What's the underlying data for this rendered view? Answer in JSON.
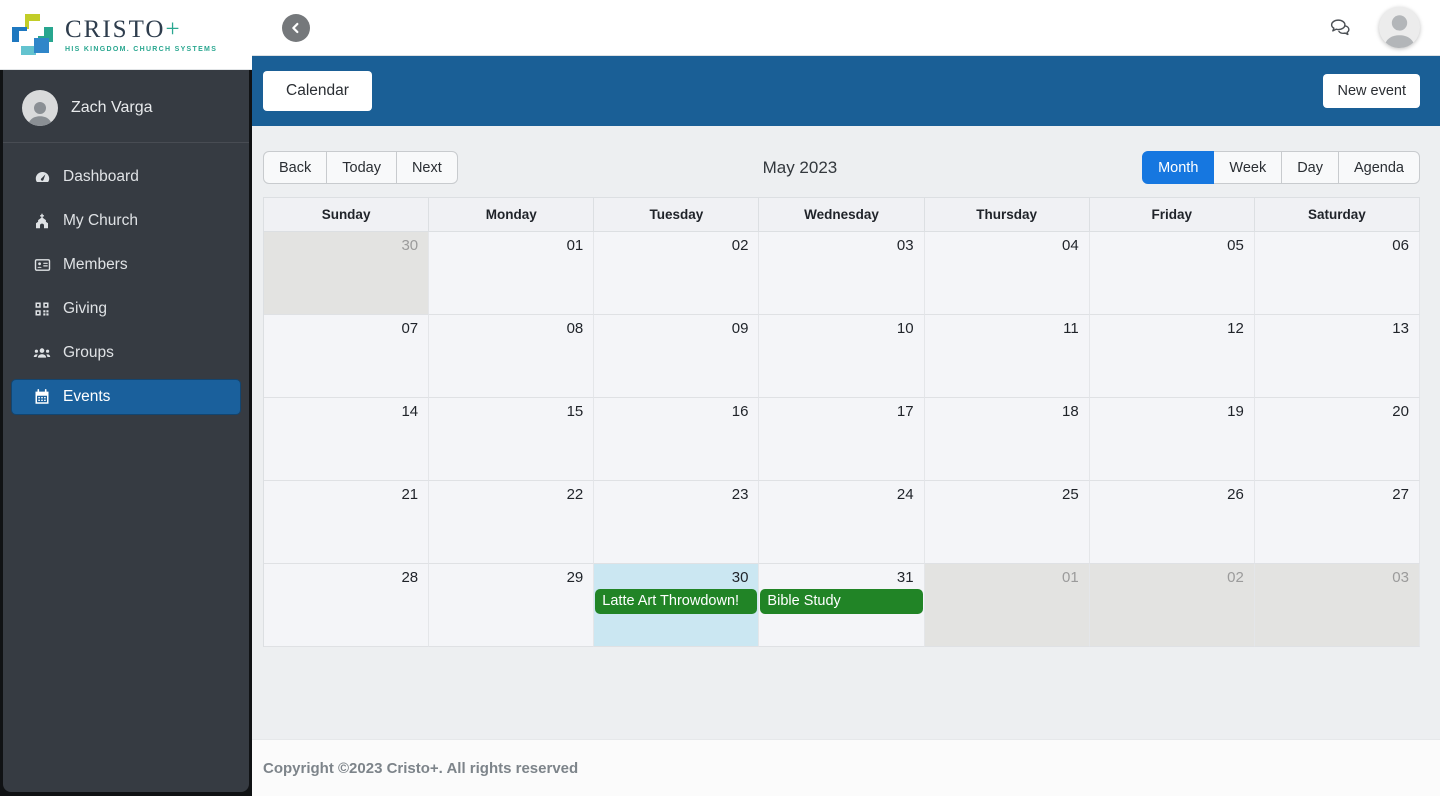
{
  "brand": {
    "name": "CRISTO",
    "plus": "+",
    "tagline": "HIS KINGDOM. CHURCH SYSTEMS"
  },
  "sidebar": {
    "user_name": "Zach Varga",
    "items": [
      {
        "label": "Dashboard",
        "icon": "dashboard-icon",
        "active": false
      },
      {
        "label": "My Church",
        "icon": "church-icon",
        "active": false
      },
      {
        "label": "Members",
        "icon": "members-icon",
        "active": false
      },
      {
        "label": "Giving",
        "icon": "giving-icon",
        "active": false
      },
      {
        "label": "Groups",
        "icon": "groups-icon",
        "active": false
      },
      {
        "label": "Events",
        "icon": "events-icon",
        "active": true
      }
    ]
  },
  "bluebar": {
    "tab_label": "Calendar",
    "new_event_label": "New event"
  },
  "toolbar": {
    "back_label": "Back",
    "today_label": "Today",
    "next_label": "Next",
    "title": "May 2023",
    "views": [
      "Month",
      "Week",
      "Day",
      "Agenda"
    ],
    "active_view": "Month"
  },
  "calendar": {
    "weekdays": [
      "Sunday",
      "Monday",
      "Tuesday",
      "Wednesday",
      "Thursday",
      "Friday",
      "Saturday"
    ],
    "rows": [
      [
        {
          "d": "30",
          "off": true
        },
        {
          "d": "01"
        },
        {
          "d": "02"
        },
        {
          "d": "03"
        },
        {
          "d": "04"
        },
        {
          "d": "05"
        },
        {
          "d": "06"
        }
      ],
      [
        {
          "d": "07"
        },
        {
          "d": "08"
        },
        {
          "d": "09"
        },
        {
          "d": "10"
        },
        {
          "d": "11"
        },
        {
          "d": "12"
        },
        {
          "d": "13"
        }
      ],
      [
        {
          "d": "14"
        },
        {
          "d": "15"
        },
        {
          "d": "16"
        },
        {
          "d": "17"
        },
        {
          "d": "18"
        },
        {
          "d": "19"
        },
        {
          "d": "20"
        }
      ],
      [
        {
          "d": "21"
        },
        {
          "d": "22"
        },
        {
          "d": "23"
        },
        {
          "d": "24"
        },
        {
          "d": "25"
        },
        {
          "d": "26"
        },
        {
          "d": "27"
        }
      ],
      [
        {
          "d": "28"
        },
        {
          "d": "29"
        },
        {
          "d": "30",
          "today": true,
          "events": [
            "Latte Art Throwdown!"
          ]
        },
        {
          "d": "31",
          "events": [
            "Bible Study"
          ]
        },
        {
          "d": "01",
          "off": true
        },
        {
          "d": "02",
          "off": true
        },
        {
          "d": "03",
          "off": true
        }
      ]
    ]
  },
  "footer": {
    "copyright": "Copyright ©2023 Cristo+. All rights reserved"
  },
  "colors": {
    "bar_blue": "#1a5f96",
    "active_item_blue": "#1a609c",
    "active_view_blue": "#1677e0",
    "event_green": "#218426",
    "today_cell_blue": "#cbe7f2",
    "brand_teal": "#2aa790"
  }
}
